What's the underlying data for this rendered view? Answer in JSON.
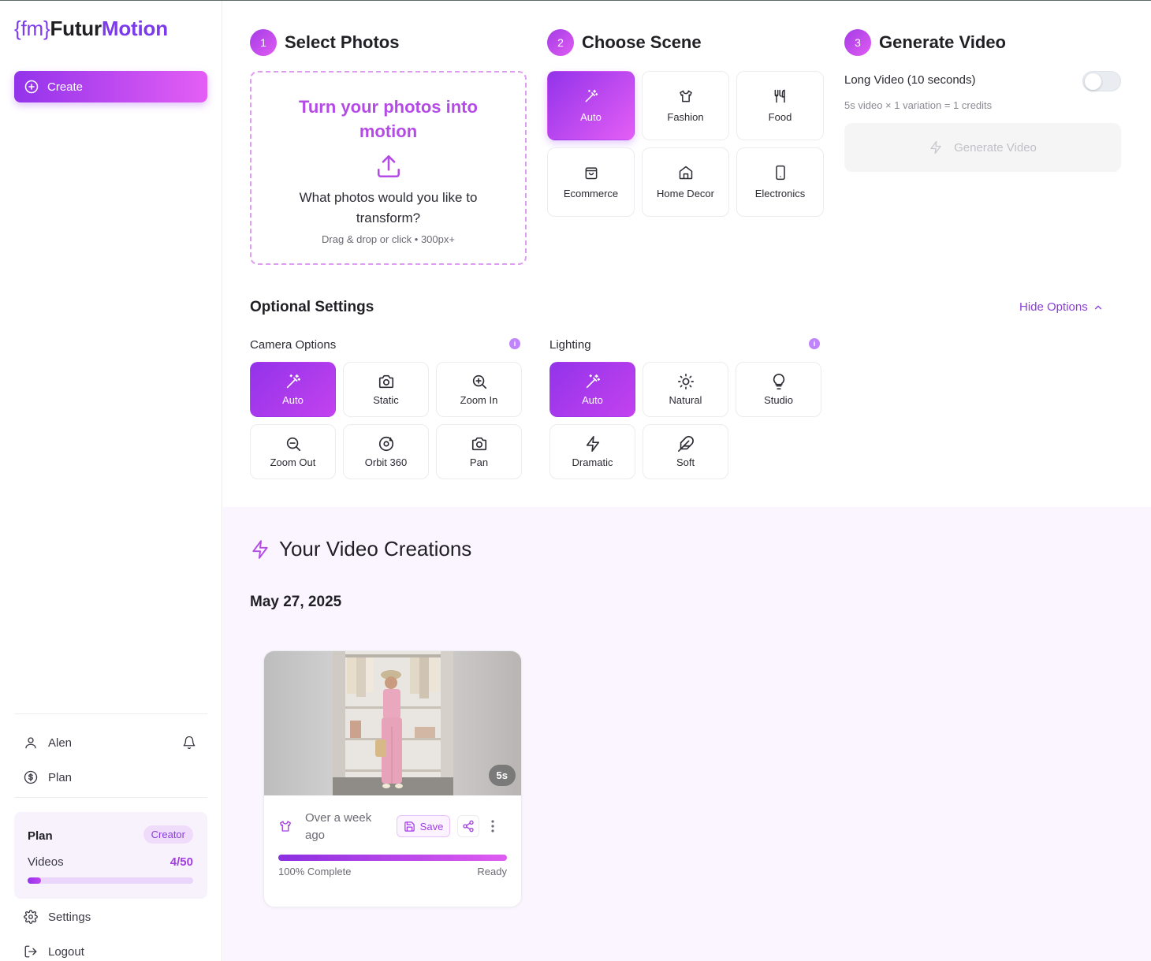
{
  "brand": {
    "brace_open": "{fm}",
    "name_part1": "Futur",
    "name_part2": "Motion"
  },
  "sidebar": {
    "create_label": "Create",
    "user_name": "Alen",
    "plan_link": "Plan",
    "settings_label": "Settings",
    "logout_label": "Logout",
    "plan_card": {
      "title": "Plan",
      "badge": "Creator",
      "videos_label": "Videos",
      "videos_count": "4/50",
      "usage_fraction": 0.08
    }
  },
  "steps": [
    {
      "num": "1",
      "title": "Select Photos"
    },
    {
      "num": "2",
      "title": "Choose Scene"
    },
    {
      "num": "3",
      "title": "Generate Video"
    }
  ],
  "upload": {
    "heading": "Turn your photos into motion",
    "question": "What photos would you like to transform?",
    "hint": "Drag & drop or click • 300px+"
  },
  "scenes": [
    {
      "label": "Auto",
      "icon": "magic-wand-icon",
      "active": true
    },
    {
      "label": "Fashion",
      "icon": "shirt-icon",
      "active": false
    },
    {
      "label": "Food",
      "icon": "utensils-icon",
      "active": false
    },
    {
      "label": "Ecommerce",
      "icon": "shopping-bag-icon",
      "active": false
    },
    {
      "label": "Home Decor",
      "icon": "home-icon",
      "active": false
    },
    {
      "label": "Electronics",
      "icon": "smartphone-icon",
      "active": false
    }
  ],
  "generate": {
    "long_video_label": "Long Video (10 seconds)",
    "long_video_on": false,
    "credits_text": "5s video × 1 variation = 1 credits",
    "button_label": "Generate Video"
  },
  "optional": {
    "title": "Optional Settings",
    "hide_label": "Hide Options",
    "camera_label": "Camera Options",
    "lighting_label": "Lighting",
    "camera": [
      {
        "label": "Auto",
        "icon": "magic-wand-icon",
        "active": true
      },
      {
        "label": "Static",
        "icon": "camera-icon",
        "active": false
      },
      {
        "label": "Zoom In",
        "icon": "zoom-in-icon",
        "active": false
      },
      {
        "label": "Zoom Out",
        "icon": "zoom-out-icon",
        "active": false
      },
      {
        "label": "Orbit 360",
        "icon": "orbit-icon",
        "active": false
      },
      {
        "label": "Pan",
        "icon": "camera-icon",
        "active": false
      }
    ],
    "lighting": [
      {
        "label": "Auto",
        "icon": "magic-wand-icon",
        "active": true
      },
      {
        "label": "Natural",
        "icon": "sun-icon",
        "active": false
      },
      {
        "label": "Studio",
        "icon": "lightbulb-icon",
        "active": false
      },
      {
        "label": "Dramatic",
        "icon": "lightning-icon",
        "active": false
      },
      {
        "label": "Soft",
        "icon": "feather-icon",
        "active": false
      }
    ]
  },
  "creations": {
    "title": "Your Video Creations",
    "date": "May 27, 2025",
    "card": {
      "duration": "5s",
      "time": "Over a week ago",
      "save_label": "Save",
      "progress_label": "100% Complete",
      "status": "Ready",
      "progress": 1.0
    }
  },
  "colors": {
    "accent": "#9333ea",
    "accent_light": "#e45ef5",
    "creations_bg": "#faf5fe"
  }
}
